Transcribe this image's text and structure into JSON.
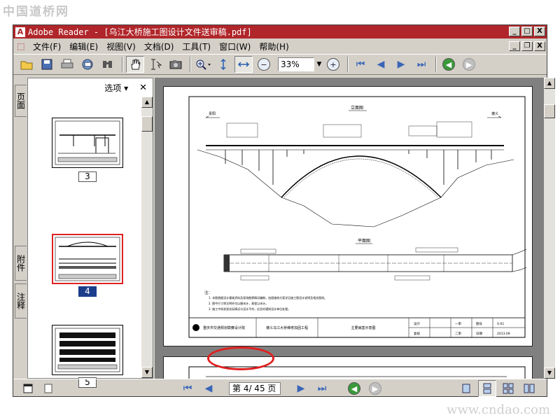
{
  "watermarks": {
    "top": "中国道桥网",
    "bottom": "www.cndao.com"
  },
  "window": {
    "app_name": "Adobe Reader",
    "title": "Adobe Reader - [乌江大桥施工图设计文件送审稿.pdf]",
    "controls": {
      "minimize": "_",
      "maximize": "□",
      "close": "X"
    }
  },
  "menu": {
    "items": [
      "文件(F)",
      "编辑(E)",
      "视图(V)",
      "文档(D)",
      "工具(T)",
      "窗口(W)",
      "帮助(H)"
    ],
    "doc_controls": {
      "minimize": "_",
      "restore": "❐",
      "close": "X"
    }
  },
  "toolbar": {
    "zoom_value": "33%",
    "icons": [
      "open-icon",
      "save-icon",
      "print-icon",
      "email-icon",
      "search-icon",
      "hand-icon",
      "select-text-icon",
      "snapshot-icon",
      "zoom-in-icon",
      "fit-page-icon",
      "fit-width-icon",
      "zoom-out-icon",
      "zoom-in-plus-icon",
      "first-page-icon",
      "prev-page-icon",
      "next-page-icon",
      "last-page-icon",
      "go-back-icon",
      "go-forward-icon"
    ]
  },
  "left_tabs": {
    "pages": "页面",
    "attachments": "附件",
    "comments": "注释"
  },
  "panel": {
    "options_label": "选项 ▾",
    "close": "✕",
    "thumbnails": [
      {
        "label": "3",
        "selected": false
      },
      {
        "label": "4",
        "selected": true
      },
      {
        "label": "5",
        "selected": false
      }
    ]
  },
  "document": {
    "drawing": {
      "elevation_title": "立面图",
      "plan_title": "平面图",
      "left_label": "贵阳",
      "right_label": "遵义",
      "notes_title": "注：",
      "notes": [
        "1. 本图根据设计基础资料及现场勘察情况编制，加固维修方案详见施工图设计说明及相关图纸。",
        "2. 图中尺寸除注明外均以厘米计，高程以米计。",
        "3. 施工中如发现实际情况与设计不符，应及时通知设计单位处理。"
      ],
      "org_name": "重庆市交通规划勘察设计院",
      "project_name": "遵义乌江大桥维修加固工程",
      "sheet_title": "主要病害示意图",
      "design_label": "设计",
      "review_label": "复核",
      "check1": "一审",
      "check2": "二审",
      "drawing_no_label": "图号",
      "date_label": "日期",
      "drawing_no": "S-01",
      "date": "2013.09"
    }
  },
  "status": {
    "page_display": "第 4/ 45 页"
  },
  "colors": {
    "titlebar": "#b0262a",
    "chrome": "#d4d0c8",
    "selection": "#1c3d8c",
    "highlight": "#e02020"
  }
}
